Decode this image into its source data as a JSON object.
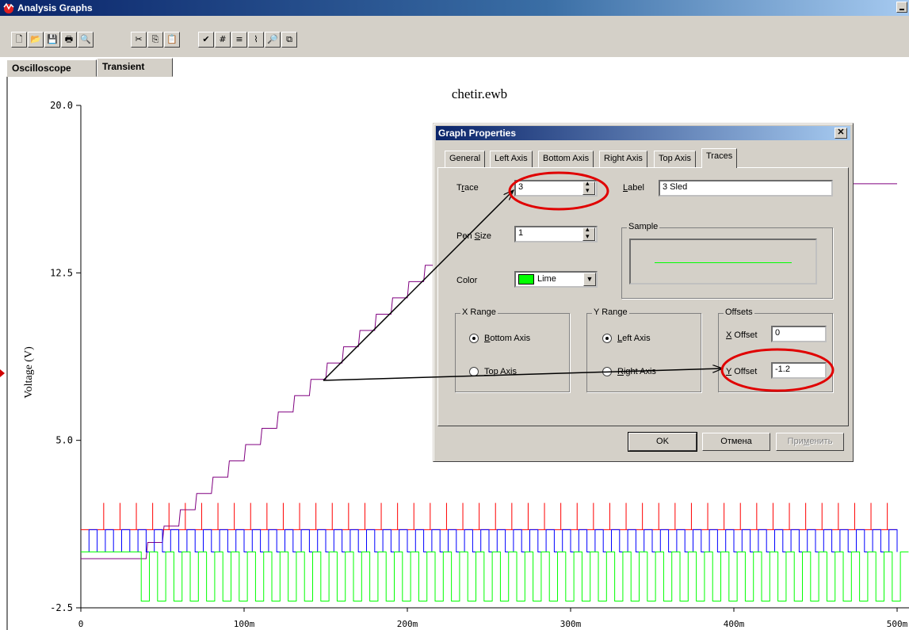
{
  "window": {
    "title": "Analysis Graphs"
  },
  "toolbar": {
    "buttons": [
      "new-icon",
      "open-icon",
      "save-icon",
      "print-icon",
      "print-preview-icon",
      "cut-icon",
      "copy-icon",
      "paste-icon",
      "properties-icon",
      "grid-icon",
      "legend-icon",
      "cursors-icon",
      "zoom-icon",
      "restore-icon"
    ],
    "glyphs": [
      "🗋",
      "📂",
      "💾",
      "🖶",
      "🔍",
      "✂",
      "⎘",
      "📋",
      "✔",
      "#",
      "≡",
      "⌇",
      "🔎",
      "⧉"
    ]
  },
  "tabs": [
    {
      "label": "Oscilloscope",
      "active": false
    },
    {
      "label": "Transient",
      "active": true
    }
  ],
  "graph": {
    "title": "chetir.ewb",
    "ylabel": "Voltage (V)",
    "yticks": [
      "20.0",
      "12.5",
      "5.0",
      "-2.5"
    ],
    "xticks": [
      "0",
      "100m",
      "200m",
      "300m",
      "400m",
      "500m"
    ]
  },
  "chart_data": {
    "type": "line",
    "title": "chetir.ewb",
    "xlabel": "",
    "ylabel": "Voltage (V)",
    "xlim": [
      0,
      0.5
    ],
    "ylim": [
      -2.5,
      20.0
    ],
    "grid": false,
    "series": [
      {
        "color": "#800080",
        "kind": "staircase",
        "x_start": 0.0,
        "y_start": -0.3,
        "step_period": 0.01,
        "step_height": 0.73,
        "y_end": 17.2
      },
      {
        "color": "#ff0000",
        "kind": "pulses",
        "period": 0.01,
        "low": 1.0,
        "high": 2.2
      },
      {
        "color": "#0000ff",
        "kind": "square",
        "period": 0.01,
        "low": 0.0,
        "high": 1.0
      },
      {
        "color": "#00ff00",
        "kind": "square",
        "period": 0.01,
        "low": -2.2,
        "high": 0.0
      }
    ]
  },
  "dialog": {
    "title": "Graph Properties",
    "close": "✕",
    "tabs": [
      "General",
      "Left Axis",
      "Bottom Axis",
      "Right Axis",
      "Top Axis",
      "Traces"
    ],
    "active_tab": "Traces",
    "trace_label": "Trace",
    "trace_value": "3",
    "label_label": "Label",
    "label_value": "3 Sled",
    "pen_size_label": "Pen Size",
    "pen_size_value": "1",
    "sample_label": "Sample",
    "color_label": "Color",
    "color_value": "Lime",
    "color_hex": "#00ff00",
    "x_range_title": "X Range",
    "x_range_options": [
      "Bottom Axis",
      "Top Axis"
    ],
    "x_range_selected": "Bottom Axis",
    "y_range_title": "Y Range",
    "y_range_options": [
      "Left Axis",
      "Right Axis"
    ],
    "y_range_selected": "Left Axis",
    "offsets_title": "Offsets",
    "x_offset_label": "X Offset",
    "x_offset_value": "0",
    "y_offset_label": "Y Offset",
    "y_offset_value": "-1.2",
    "ok_label": "OK",
    "cancel_label": "Отмена",
    "apply_label": "Применить"
  }
}
